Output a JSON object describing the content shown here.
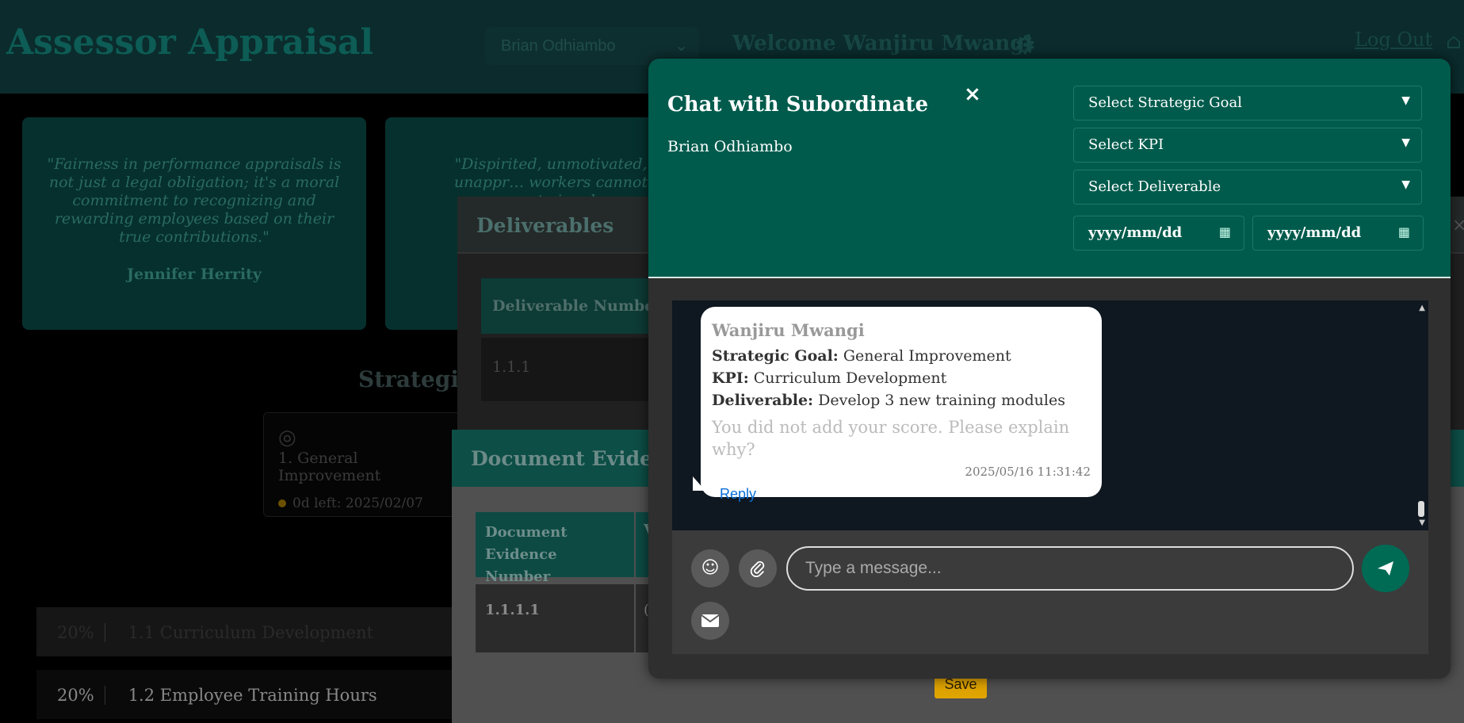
{
  "header": {
    "app_title": "Assessor Appraisal",
    "employee_select": "Brian Odhiambo",
    "welcome": "Welcome Wanjiru Mwangi",
    "logout": "Log Out"
  },
  "quotes": [
    {
      "text": "\"Fairness in performance appraisals is not just a legal obligation; it's a moral commitment to recognizing and rewarding employees based on their true contributions.\"",
      "author": "Jennifer Herrity"
    },
    {
      "text": "\"Dispirited, unmotivated, unappr… workers cannot compete in a h…",
      "author": ""
    }
  ],
  "strategic": {
    "section_title": "Strategic",
    "goal_label": "1. General Improvement",
    "goal_due": "0d left: 2025/02/07"
  },
  "kpi_rows": [
    {
      "pct": "20%",
      "label": "1.1 Curriculum Development"
    },
    {
      "pct": "20%",
      "label": "1.2 Employee Training Hours"
    }
  ],
  "deliverables_panel": {
    "title": "Deliverables",
    "col_header": "Deliverable Number",
    "row_1": "1.1.1",
    "close": "×"
  },
  "document_panel": {
    "title": "Document Evidence",
    "col_header": "Document Evidence Number",
    "col2_header": "V",
    "row_1": "1.1.1.1",
    "row_1_col2": "(",
    "save": "Save"
  },
  "chat": {
    "title": "Chat with Subordinate",
    "subordinate": "Brian Odhiambo",
    "close": "×",
    "select_goal": "Select Strategic Goal",
    "select_kpi": "Select KPI",
    "select_deliverable": "Select Deliverable",
    "date_from_placeholder": "yyyy/mm/dd",
    "date_to_placeholder": "yyyy/mm/dd",
    "message": {
      "sender": "Wanjiru Mwangi",
      "goal_label": "Strategic Goal:",
      "goal_value": "General Improvement",
      "kpi_label": "KPI:",
      "kpi_value": "Curriculum Development",
      "deliverable_label": "Deliverable:",
      "deliverable_value": "Develop 3 new training modules",
      "question": "You did not add your score. Please explain why?",
      "timestamp": "2025/05/16 11:31:42",
      "reply": "Reply"
    },
    "input_placeholder": "Type a message..."
  },
  "icons": {
    "emoji": "emoji-icon",
    "attach": "paperclip-icon",
    "send": "send-icon",
    "email": "envelope-icon",
    "gear": "gear-icon",
    "home": "home-icon"
  },
  "colors": {
    "chat_header": "#005b4c",
    "send_button": "#006b55",
    "reply_link": "#0a6fd6",
    "save_button": "#e0a400"
  }
}
